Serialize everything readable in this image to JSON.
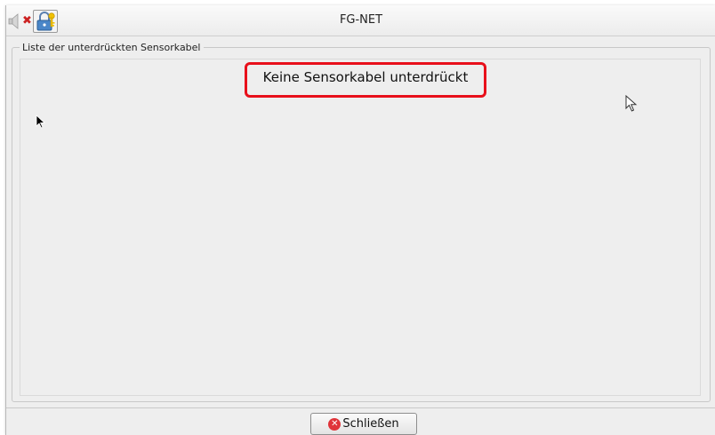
{
  "window": {
    "title": "FG-NET"
  },
  "titlebar_icons": [
    "speaker-icon",
    "mute-x-icon",
    "lock-key-icon"
  ],
  "panel": {
    "legend": "Liste der unterdrückten Sensorkabel",
    "empty_message": "Keine Sensorkabel unterdrückt"
  },
  "footer": {
    "close_button": {
      "label": "Schließen",
      "icon": "close-circle-icon"
    }
  },
  "colors": {
    "highlight_border": "#e8101b",
    "window_background": "#eeeeee",
    "close_icon": "#e0343a"
  }
}
